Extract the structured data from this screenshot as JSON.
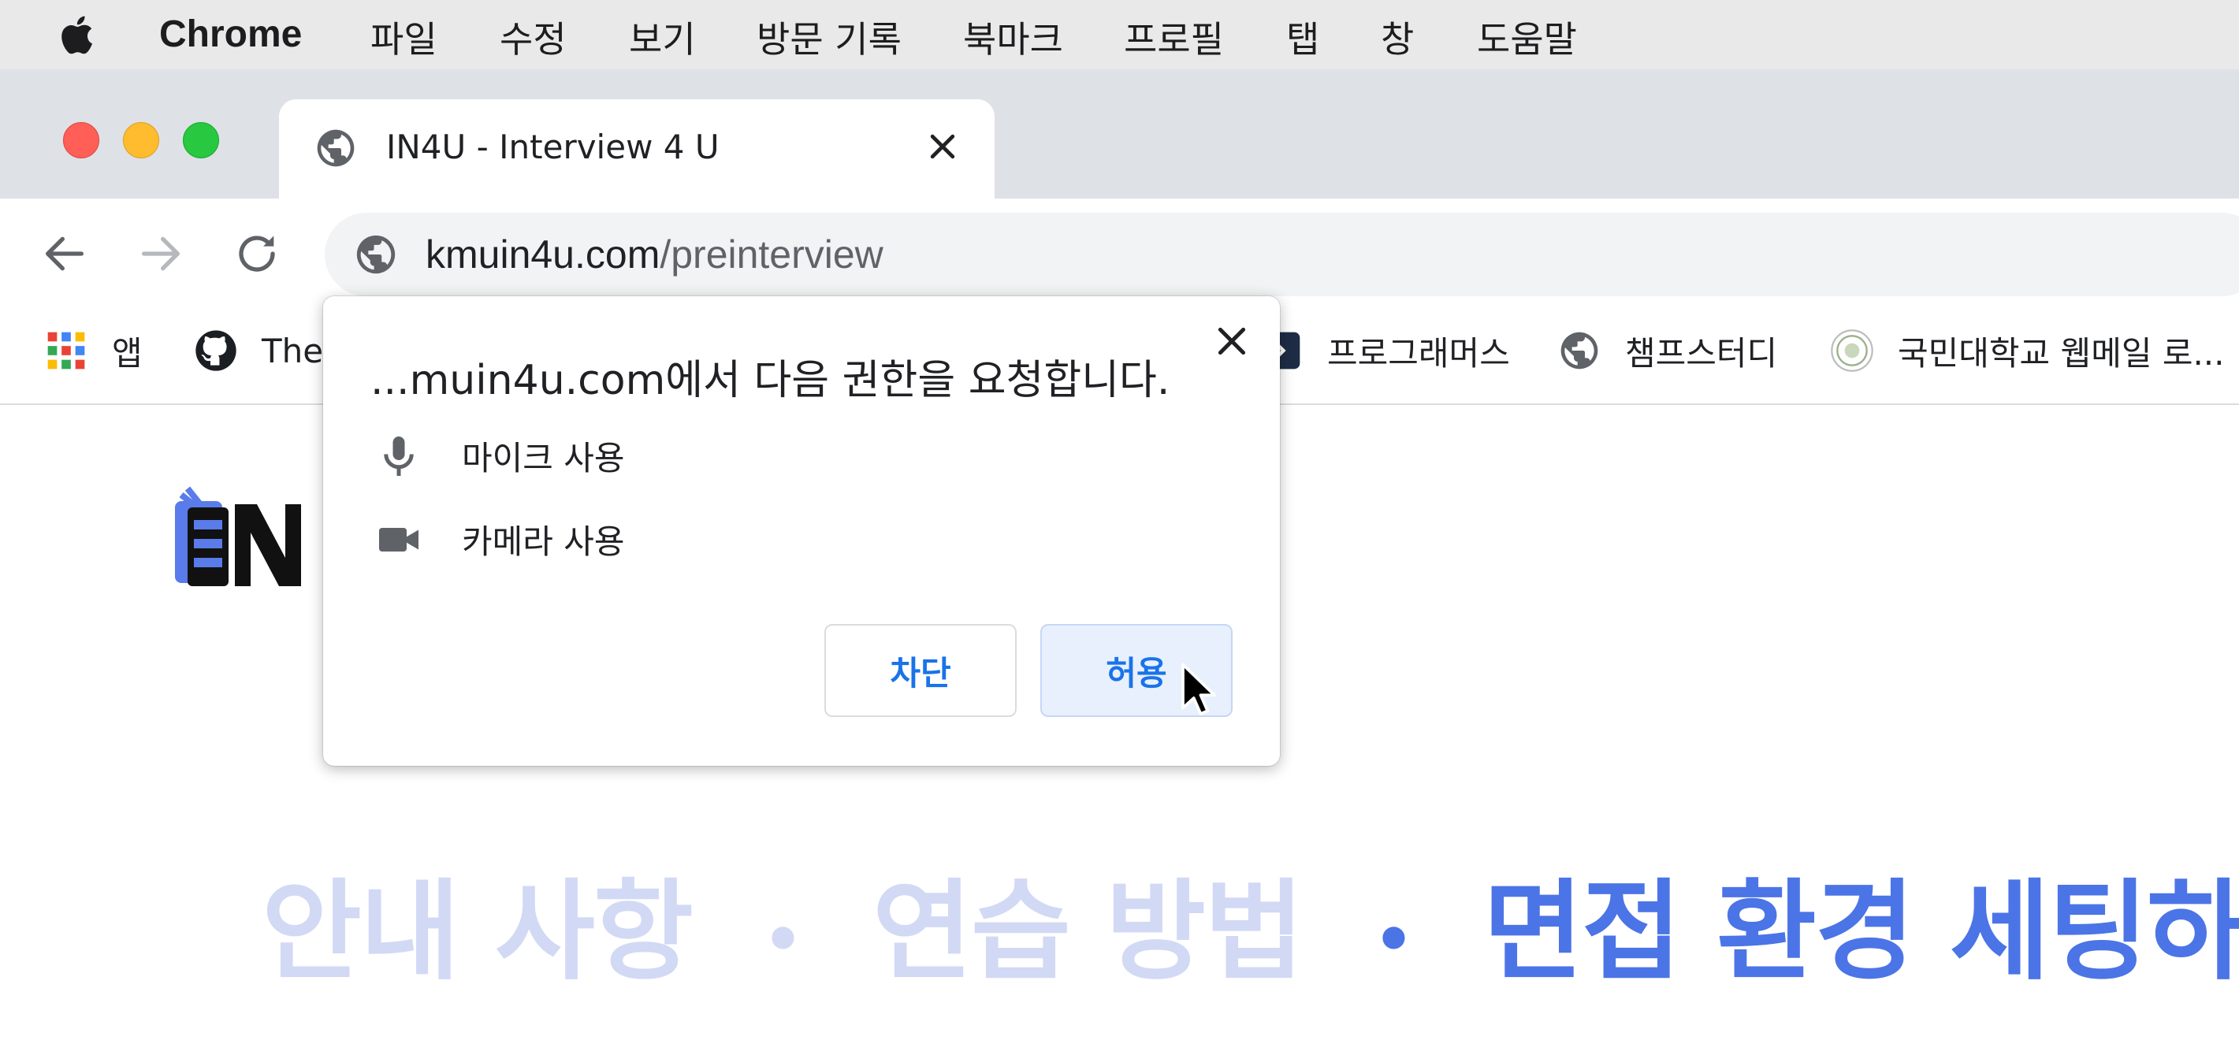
{
  "menubar": {
    "app_name": "Chrome",
    "items": [
      "파일",
      "수정",
      "보기",
      "방문 기록",
      "북마크",
      "프로필",
      "탭",
      "창",
      "도움말"
    ]
  },
  "tab": {
    "title": "IN4U - Interview 4 U"
  },
  "omnibox": {
    "domain": "kmuin4u.com",
    "path": "/preinterview"
  },
  "bookmarks": {
    "items": [
      "앱",
      "The",
      "프로그래머스",
      "챔프스터디",
      "국민대학교 웹메일 로..."
    ]
  },
  "dialog": {
    "title": "...muin4u.com에서 다음 권한을 요청합니다.",
    "permissions": [
      {
        "label": "마이크 사용",
        "icon": "microphone-icon"
      },
      {
        "label": "카메라 사용",
        "icon": "camera-icon"
      }
    ],
    "block_label": "차단",
    "allow_label": "허용"
  },
  "page": {
    "steps": [
      "안내 사항",
      "연습 방법",
      "면접 환경 세팅하기"
    ],
    "separator": "•",
    "active_step": 2
  },
  "colors": {
    "step_active": "#4b74e6",
    "step_faded": "#d2d9f5",
    "link_blue": "#1a73e8"
  }
}
